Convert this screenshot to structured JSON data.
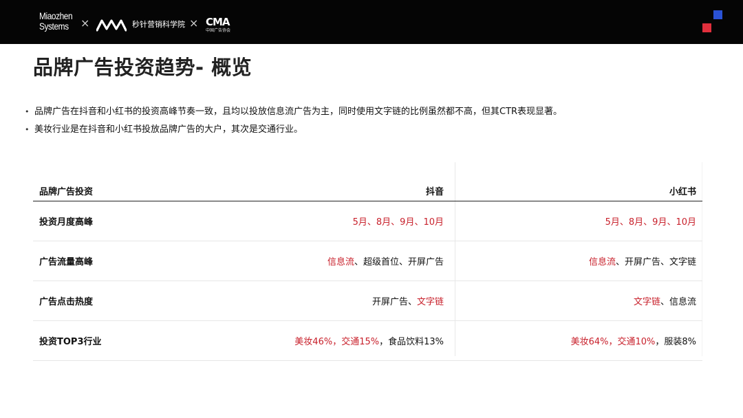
{
  "header": {
    "logo_line1": "Miaozhen",
    "logo_line2": "Systems",
    "separator": "×",
    "partner_name": "秒针营销科学院",
    "partner2_mark": "CMA",
    "partner2_sub": "中国广告协会",
    "accent_colors": {
      "blue": "#2a52d6",
      "red": "#e12f3c"
    }
  },
  "title": "品牌广告投资趋势- 概览",
  "bullets": [
    "品牌广告在抖音和小红书的投资高峰节奏一致，且均以投放信息流广告为主，同时使用文字链的比例虽然都不高，但其CTR表现显著。",
    "美妆行业是在抖音和小红书投放品牌广告的大户，其次是交通行业。"
  ],
  "table": {
    "headers": [
      "品牌广告投资",
      "抖音",
      "小红书"
    ],
    "rows": [
      {
        "label": "投资月度高峰",
        "douyin": [
          {
            "t": "5月、8月、9月、10月",
            "red": true
          }
        ],
        "xhs": [
          {
            "t": "5月、8月、9月、10月",
            "red": true
          }
        ]
      },
      {
        "label": "广告流量高峰",
        "douyin": [
          {
            "t": "信息流",
            "red": true
          },
          {
            "t": "、超级首位、开屏广告",
            "red": false
          }
        ],
        "xhs": [
          {
            "t": "信息流",
            "red": true
          },
          {
            "t": "、开屏广告、文字链",
            "red": false
          }
        ]
      },
      {
        "label": "广告点击热度",
        "douyin": [
          {
            "t": "开屏广告、",
            "red": false
          },
          {
            "t": "文字链",
            "red": true
          }
        ],
        "xhs": [
          {
            "t": "文字链",
            "red": true
          },
          {
            "t": "、信息流",
            "red": false
          }
        ]
      },
      {
        "label": "投资TOP3行业",
        "douyin": [
          {
            "t": "美妆46%，交通15%",
            "red": true
          },
          {
            "t": "，食品饮料13%",
            "red": false
          }
        ],
        "xhs": [
          {
            "t": "美妆64%，交通10%",
            "red": true
          },
          {
            "t": "，服装8%",
            "red": false
          }
        ]
      }
    ],
    "highlight_color": "#c8202b"
  }
}
